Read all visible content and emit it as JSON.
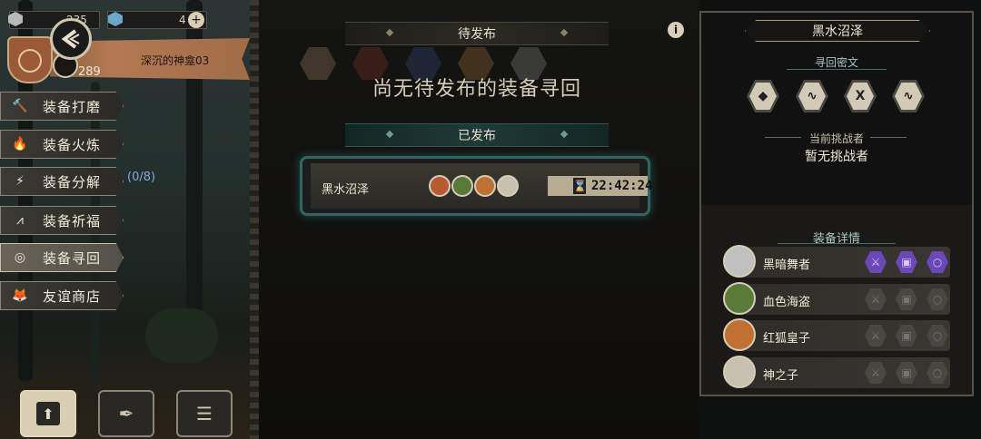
{
  "top_stats": {
    "resource_a_value": "235",
    "resource_b_value": "4"
  },
  "profile": {
    "level": "289",
    "banner_name": "深沉的神龛03"
  },
  "menu": {
    "items": [
      {
        "label": "装备打磨",
        "icon": "hammer-icon"
      },
      {
        "label": "装备火炼",
        "icon": "flame-icon"
      },
      {
        "label": "装备分解",
        "icon": "disassemble-icon"
      },
      {
        "label": "装备祈福",
        "icon": "pray-icon"
      },
      {
        "label": "装备寻回",
        "icon": "target-icon"
      },
      {
        "label": "友谊商店",
        "icon": "fox-icon"
      }
    ],
    "disassemble_count": "(0/8)"
  },
  "center": {
    "pending_header": "待发布",
    "empty_message": "尚无待发布的装备寻回",
    "published_header": "已发布",
    "published_card": {
      "location": "黑水沼泽",
      "timer": "22:42:24"
    }
  },
  "right_panel": {
    "title": "黑水沼泽",
    "runes_header": "寻回密文",
    "challenger_header": "当前挑战者",
    "challenger_value": "暂无挑战者",
    "details_header": "装备详情",
    "heroes": [
      {
        "name": "黑暗舞者",
        "active": true
      },
      {
        "name": "血色海盗",
        "active": false
      },
      {
        "name": "红狐皇子",
        "active": false
      },
      {
        "name": "神之子",
        "active": false
      }
    ]
  },
  "colors": {
    "accent_teal": "#2f6662",
    "equip_purple": "#6a48b8",
    "banner_brown": "#b27a52"
  }
}
